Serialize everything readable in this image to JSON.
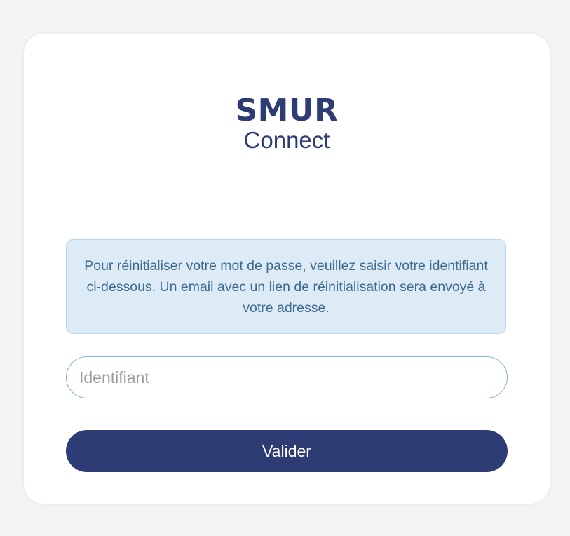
{
  "logo": {
    "title": "SMUR",
    "subtitle": "Connect"
  },
  "info": {
    "message": "Pour réinitialiser votre mot de passe, veuillez saisir votre identifiant ci-dessous. Un email avec un lien de réinitialisation sera envoyé à votre adresse."
  },
  "form": {
    "identifier_placeholder": "Identifiant",
    "identifier_value": "",
    "submit_label": "Valider"
  },
  "colors": {
    "brand": "#2e3c75",
    "info_background": "#dcebf6",
    "info_text": "#3f6a8e",
    "background": "#f4f4f4"
  }
}
